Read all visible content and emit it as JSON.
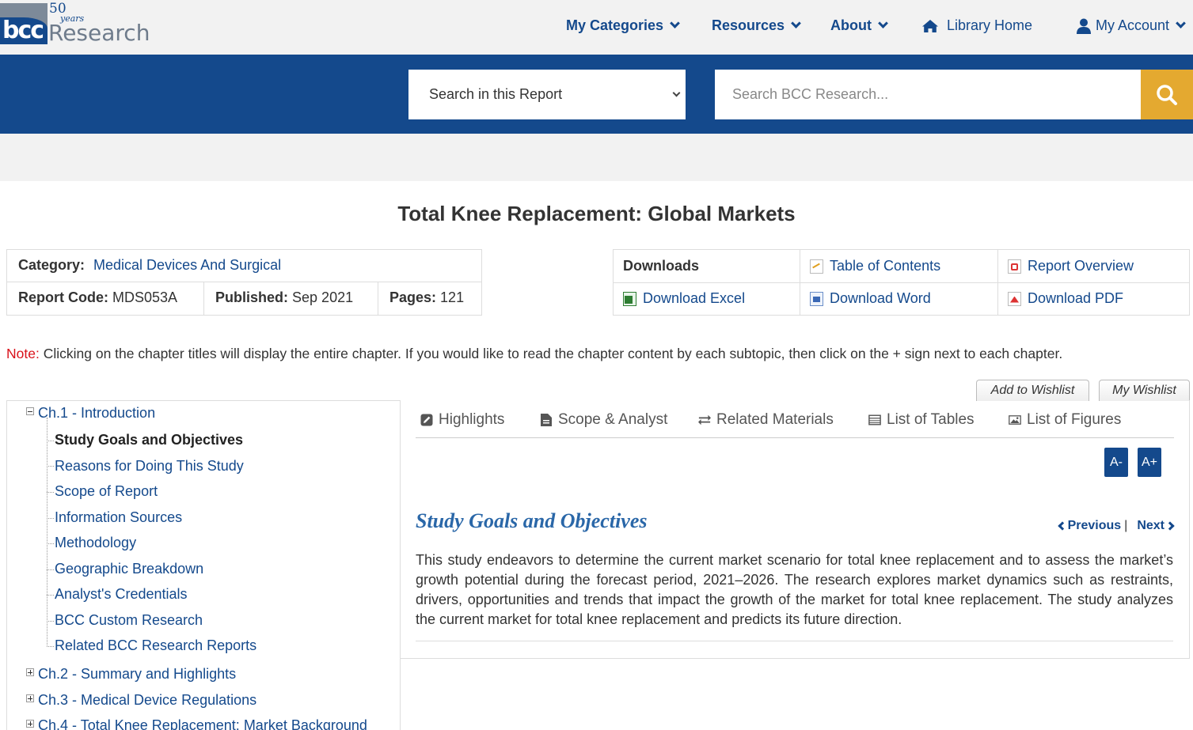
{
  "header": {
    "logo": {
      "fifty": "50",
      "years": "years",
      "bcc": "bcc",
      "research": "Research"
    },
    "nav": {
      "categories": "My Categories",
      "resources": "Resources",
      "about": "About",
      "library_home": "Library Home",
      "account": "My Account"
    }
  },
  "search": {
    "scope_selected": "Search in this Report",
    "placeholder": "Search BCC Research...",
    "button_color": "#e4a930"
  },
  "report": {
    "title": "Total Knee Replacement: Global Markets",
    "category_label": "Category:",
    "category_value": "Medical Devices And Surgical",
    "code_label": "Report Code:",
    "code_value": "MDS053A",
    "published_label": "Published:",
    "published_value": "Sep 2021",
    "pages_label": "Pages:",
    "pages_value": "121"
  },
  "downloads": {
    "heading": "Downloads",
    "toc": "Table of Contents",
    "overview": "Report Overview",
    "excel": "Download Excel",
    "word": "Download Word",
    "pdf": "Download PDF"
  },
  "note": {
    "label": "Note:",
    "text": "Clicking on the chapter titles will display the entire chapter. If you would like to read the chapter content by each subtopic, then click on the + sign next to each chapter."
  },
  "wishlist": {
    "add": "Add to Wishlist",
    "mine": "My Wishlist"
  },
  "toc": {
    "ch1": "Ch.1 - Introduction",
    "ch1_items": [
      "Study Goals and Objectives",
      "Reasons for Doing This Study",
      "Scope of Report",
      "Information Sources",
      "Methodology",
      "Geographic Breakdown",
      "Analyst's Credentials",
      "BCC Custom Research",
      "Related BCC Research Reports"
    ],
    "ch2": "Ch.2 - Summary and Highlights",
    "ch3": "Ch.3 - Medical Device Regulations",
    "ch4": "Ch.4 - Total Knee Replacement: Market Background"
  },
  "tabs": {
    "highlights": "Highlights",
    "scope": "Scope & Analyst",
    "related": "Related Materials",
    "tables": "List of Tables",
    "figures": "List of Figures"
  },
  "content": {
    "font_minus": "A-",
    "font_plus": "A+",
    "section_title": "Study Goals and Objectives",
    "previous": "Previous",
    "separator": "|",
    "next": "Next",
    "body": "This study endeavors to determine the current market scenario for total knee replacement and to assess the market’s growth potential during the forecast period, 2021–2026. The research explores market dynamics such as restraints, drivers, opportunities and trends that impact the growth of the market for total knee replacement. The study analyzes the current market for total knee replacement and predicts its future direction."
  },
  "colors": {
    "brand_blue": "#14498c",
    "note_red": "#d9111a",
    "section_title": "#2a67a8"
  }
}
